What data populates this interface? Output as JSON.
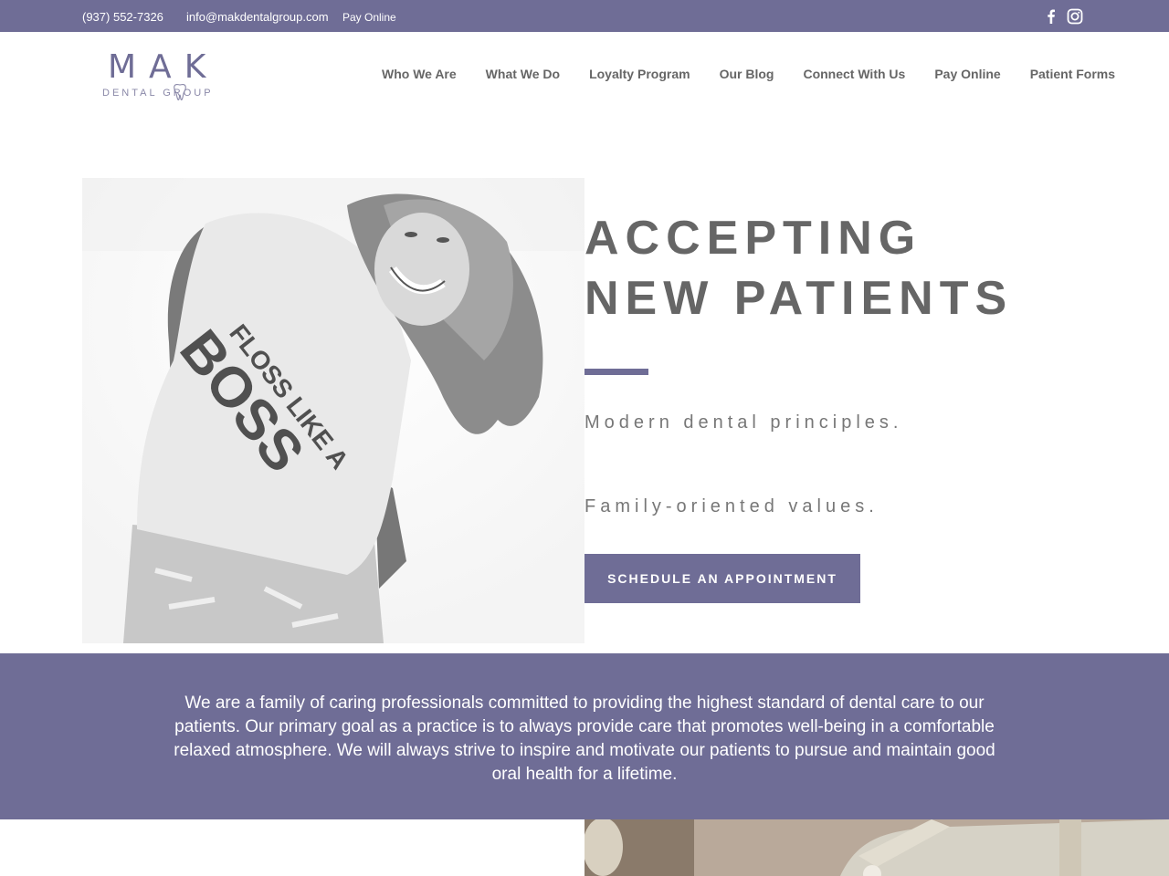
{
  "topbar": {
    "phone": "(937) 552-7326",
    "email": "info@makdentalgroup.com",
    "pay_online": "Pay Online",
    "social": [
      {
        "icon": "facebook-icon"
      },
      {
        "icon": "instagram-icon"
      }
    ]
  },
  "logo": {
    "name": "MAK",
    "subtitle": "DENTAL   GROUP"
  },
  "nav": {
    "items": [
      {
        "label": "Who We Are"
      },
      {
        "label": "What We Do"
      },
      {
        "label": "Loyalty Program"
      },
      {
        "label": "Our Blog"
      },
      {
        "label": "Connect With Us"
      },
      {
        "label": "Pay Online"
      },
      {
        "label": "Patient Forms"
      }
    ]
  },
  "hero": {
    "title_line1": "ACCEPTING",
    "title_line2": "NEW PATIENTS",
    "tagline1": "Modern dental principles.",
    "tagline2": "Family-oriented values.",
    "cta_label": "SCHEDULE AN APPOINTMENT",
    "shirt_text_1": "FLOSS LIKE A",
    "shirt_text_2": "BOSS"
  },
  "mission": {
    "text": "We are a family of caring professionals committed to providing the highest standard of dental care to our patients. Our primary goal as a practice is to always provide care that promotes well-being in a comfortable relaxed atmosphere. We will always strive to inspire and motivate our patients to pursue and maintain good oral health for a lifetime."
  },
  "colors": {
    "brand": "#6f6d96",
    "text": "#666666"
  }
}
